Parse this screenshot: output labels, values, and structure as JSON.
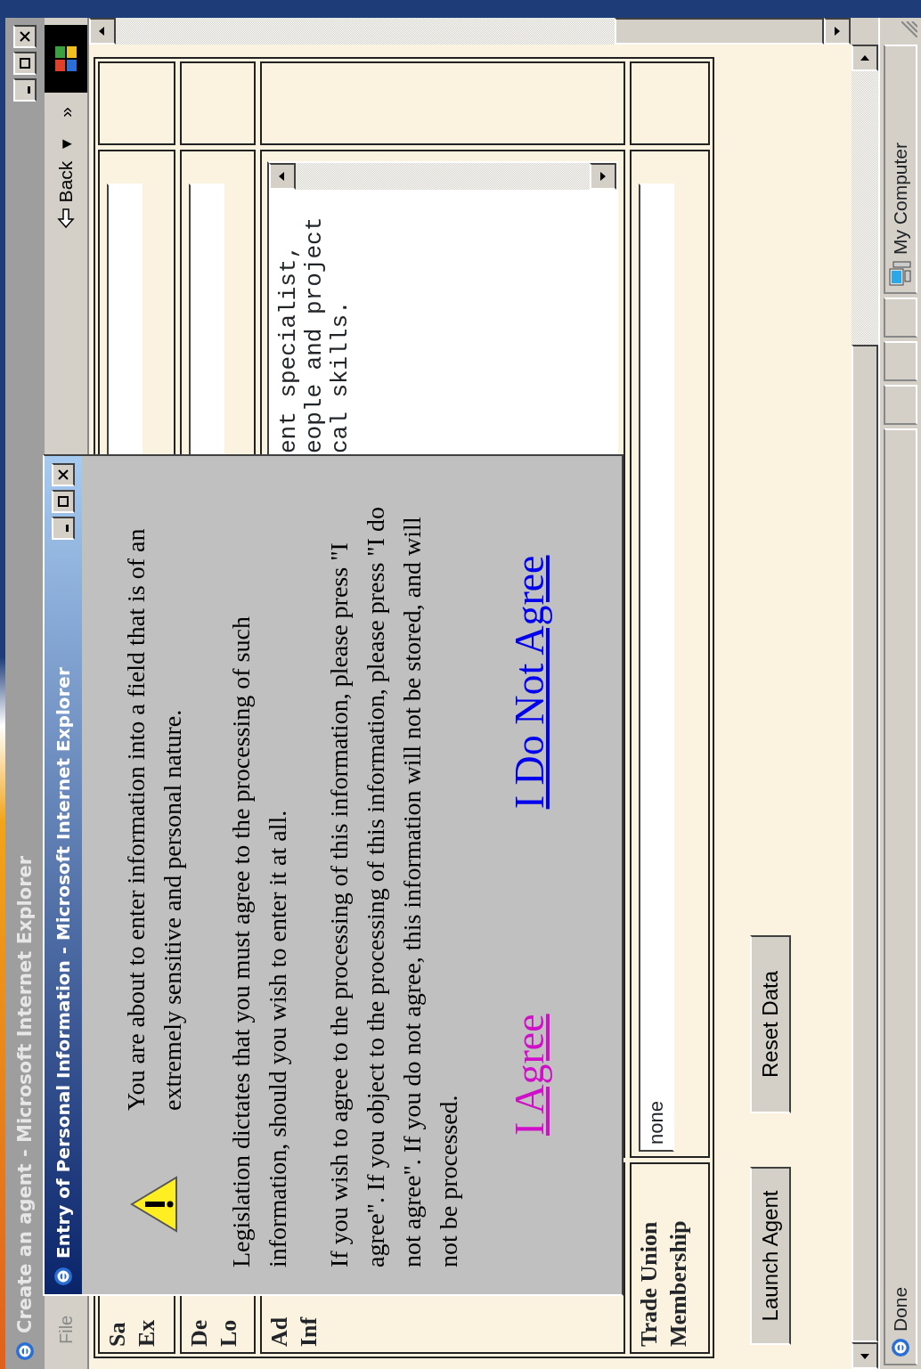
{
  "browser": {
    "title": "Create an agent - Microsoft Internet Explorer",
    "menu": [
      "File"
    ],
    "toolbar": {
      "back": "Back",
      "caret": "▾",
      "more": "»"
    }
  },
  "form": {
    "rows": [
      {
        "kind": "input",
        "label_lines": [
          "Sa",
          "Ex"
        ]
      },
      {
        "kind": "input",
        "label_lines": [
          "De",
          "Lo"
        ]
      },
      {
        "kind": "textarea",
        "label_lines": [
          "Ad",
          "Inf"
        ],
        "lines": [
          "ent specialist,",
          "eople and project",
          "cal skills."
        ]
      },
      {
        "kind": "input",
        "label_lines": [
          "Trade Union",
          "Membership"
        ],
        "value": "none"
      }
    ],
    "buttons": [
      "Launch Agent",
      "Reset Data"
    ]
  },
  "dialog": {
    "title": "Entry of Personal Information - Microsoft Internet Explorer",
    "paragraphs": [
      "You are about to enter information into a field that is of an extremely sensitive and personal nature.",
      "Legislation dictates that you must agree to the processing of such information, should you wish to enter it at all.",
      "If you wish to agree to the processing of this information, please press \"I agree\". If you object to the processing of this information, please press \"I do not agree\". If you do not agree, this information will not be stored, and will not be processed."
    ],
    "links": [
      {
        "text": "I Agree",
        "visited": true
      },
      {
        "text": "I Do Not Agree",
        "visited": false
      }
    ]
  },
  "status_bar": {
    "text": "Done",
    "zone": "My Computer"
  }
}
